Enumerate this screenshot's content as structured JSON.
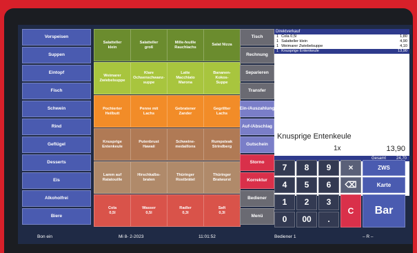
{
  "categories": [
    "Vorspeisen",
    "Suppen",
    "Eintopf",
    "Fisch",
    "Schwein",
    "Rind",
    "Geflügel",
    "Desserts",
    "Eis",
    "Alkoholfrei",
    "Biere"
  ],
  "products": [
    [
      "Salatteller\nklein",
      "Salatteller\ngroß",
      "Mille-feuille\nRauchlachs",
      "Salat Nizza"
    ],
    [
      "Weimarer\nZwiebelsuppe",
      "Klare\nOchsenschwanz-\nsuppe",
      "Latte\nMacchiato\nMarona",
      "Bananen-\nKokos-\nSuppe"
    ],
    [
      "Pochierter\nHeilbutt",
      "Penne mit\nLachs",
      "Gebratener\nZander",
      "Gegrillter\nLachs"
    ],
    [
      "Knusprige\nEntenkeule",
      "Putenbrust\nHawaii",
      "Schweine-\nmedaillons",
      "Rumpsteak\nStrindberg"
    ],
    [
      "Lamm auf\nRatatouille",
      "Hirschkalbs-\nbraten",
      "Thüringer\nRostbrätel",
      "Thüringer\nBratwurst"
    ],
    [
      "Cola\n0,5l",
      "Wasser\n0,5l",
      "Radler\n0,3l",
      "Saft\n0,3l"
    ]
  ],
  "row_colors": [
    "#6b8c2e",
    "#a8c53e",
    "#f28c28",
    "#b07a55",
    "#b08a6a",
    "#d9534a"
  ],
  "functions": [
    "Tisch",
    "Rechnung",
    "Separieren",
    "Transfer",
    "Ein-/Auszahlung",
    "Auf-/Abschlag",
    "Gutschein",
    "Storno",
    "Korrektur",
    "Bediener",
    "Menü"
  ],
  "function_colors": [
    "#6a6a72",
    "#6a6a72",
    "#6a6a72",
    "#6a6a72",
    "#7a7ec8",
    "#7a7ec8",
    "#7a7ec8",
    "#d9304a",
    "#d9304a",
    "#6a6a72",
    "#6a6a72"
  ],
  "order": {
    "header": "Direktverkauf",
    "items": [
      {
        "qty": "1",
        "name": "Cola 0,5l",
        "price": "1,80"
      },
      {
        "qty": "1",
        "name": "Salatteller klein",
        "price": "4,90"
      },
      {
        "qty": "1",
        "name": "Weimarer Zwiebelsuppe",
        "price": "4,10"
      },
      {
        "qty": "1",
        "name": "Knusprige Entenkeule",
        "price": "13,90"
      }
    ],
    "selected_name": "Knusprige Entenkeule",
    "selected_qty": "1x",
    "selected_price": "13,90",
    "total_label": "Gesamt",
    "total_value": "24,70"
  },
  "keypad": {
    "keys": [
      "7",
      "8",
      "9",
      "×",
      "ZWS",
      "4",
      "5",
      "6",
      "⌫",
      "Karte",
      "1",
      "2",
      "3",
      "C",
      "Bar",
      "0",
      "00",
      "."
    ]
  },
  "status": {
    "left": "Bon ein",
    "date": "Mi  8- 2-2023",
    "time": "11:01:52",
    "user": "Bediener 1",
    "right": "– R –"
  }
}
